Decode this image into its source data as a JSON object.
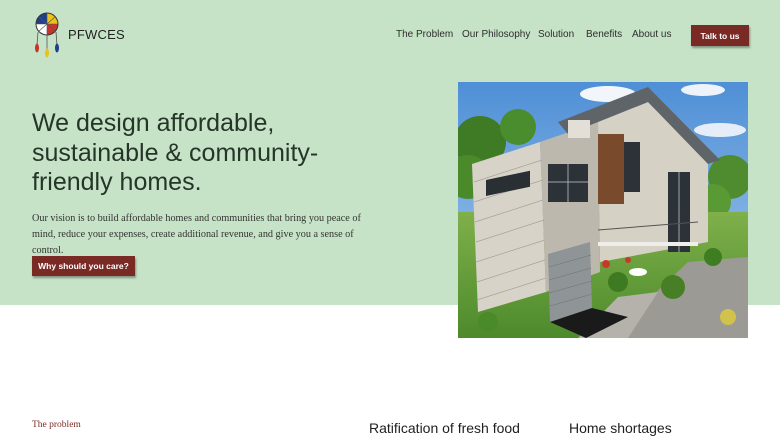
{
  "brand": {
    "name": "PFWCES"
  },
  "nav": {
    "items": [
      "The Problem",
      "Our Philosophy",
      "Solution",
      "Benefits",
      "About us"
    ],
    "cta": "Talk to us"
  },
  "hero": {
    "headline": "We design affordable, sustainable & community-friendly homes.",
    "body": "Our vision is to build affordable homes and communities that bring you peace of mind, reduce your expenses, create additional revenue, and give you a sense of control.",
    "button": "Why should you care?"
  },
  "problem": {
    "eyebrow": "The problem",
    "columns": [
      "Ratification of fresh food",
      "Home shortages"
    ]
  },
  "colors": {
    "hero_bg": "#c6e3c7",
    "accent": "#7a2a24",
    "headline": "#253528"
  },
  "icons": {
    "logo": "dreamcatcher-logo-icon"
  }
}
